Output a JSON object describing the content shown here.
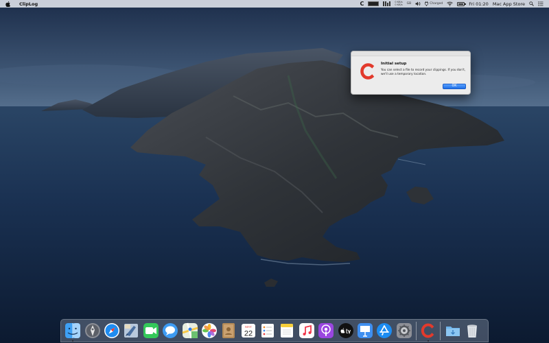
{
  "menubar": {
    "app_name": "ClipLog",
    "status_c": "C",
    "stat_rows": [
      "0 KB/s",
      "0 KB/s"
    ],
    "memory_label": "GB",
    "battery_status": "Charged",
    "battery_level": 1.0,
    "clock": "Fri 01:20",
    "store_label": "Mac App Store"
  },
  "dialog": {
    "title": "Initial setup",
    "message": "You can select a file to record your clippings. If you don't, we'll use a temporary location.",
    "ok_label": "OK",
    "icon_letter": "C",
    "icon_color": "#e23a2c"
  },
  "dock": {
    "items": [
      {
        "name": "finder-icon",
        "running": true
      },
      {
        "name": "launchpad-icon",
        "running": false
      },
      {
        "name": "safari-icon",
        "running": false
      },
      {
        "name": "mail-icon",
        "running": false
      },
      {
        "name": "facetime-icon",
        "running": false
      },
      {
        "name": "messages-icon",
        "running": false
      },
      {
        "name": "maps-icon",
        "running": false
      },
      {
        "name": "photos-icon",
        "running": false
      },
      {
        "name": "contacts-icon",
        "running": false
      },
      {
        "name": "calendar-icon",
        "running": false,
        "month": "MAY",
        "day": "22"
      },
      {
        "name": "reminders-icon",
        "running": false
      },
      {
        "name": "notes-icon",
        "running": false
      },
      {
        "name": "music-icon",
        "running": false
      },
      {
        "name": "podcasts-icon",
        "running": false
      },
      {
        "name": "tv-icon",
        "running": false
      },
      {
        "name": "keynote-icon",
        "running": false
      },
      {
        "name": "app-store-icon",
        "running": false
      },
      {
        "name": "system-preferences-icon",
        "running": false
      },
      {
        "name": "cliplog-icon",
        "running": true,
        "letter": "C"
      },
      {
        "name": "downloads-folder-icon",
        "running": false
      },
      {
        "name": "trash-icon",
        "running": false
      }
    ]
  },
  "colors": {
    "accent": "#1f6fe6",
    "brand": "#e23a2c"
  }
}
